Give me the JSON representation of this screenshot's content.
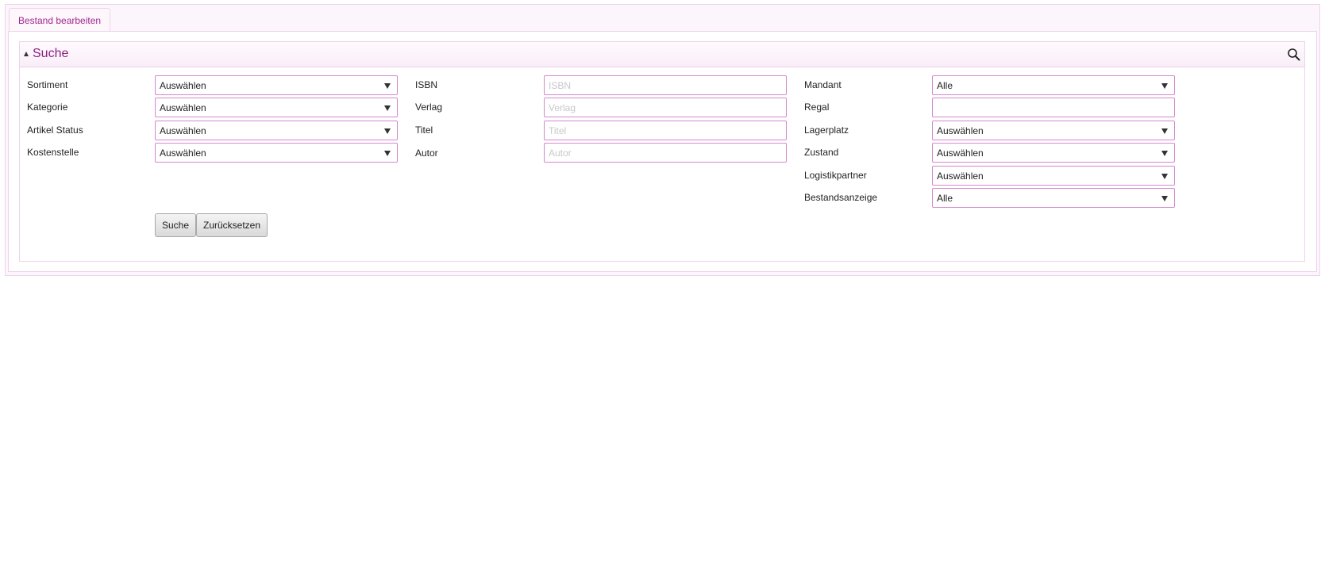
{
  "tabs": [
    {
      "label": "Bestand bearbeiten"
    }
  ],
  "search_panel": {
    "title": "Suche",
    "search_icon": "search-icon",
    "collapse_icon": "triangle-up-icon"
  },
  "columns": {
    "left": [
      {
        "label": "Sortiment",
        "value": "Auswählen"
      },
      {
        "label": "Kategorie",
        "value": "Auswählen"
      },
      {
        "label": "Artikel Status",
        "value": "Auswählen"
      },
      {
        "label": "Kostenstelle",
        "value": "Auswählen"
      }
    ],
    "middle": [
      {
        "label": "ISBN",
        "placeholder": "ISBN"
      },
      {
        "label": "Verlag",
        "placeholder": "Verlag"
      },
      {
        "label": "Titel",
        "placeholder": "Titel"
      },
      {
        "label": "Autor",
        "placeholder": "Autor"
      }
    ],
    "right": [
      {
        "label": "Mandant",
        "value": "Alle"
      },
      {
        "label": "Regal",
        "value": ""
      },
      {
        "label": "Lagerplatz",
        "value": "Auswählen"
      },
      {
        "label": "Zustand",
        "value": "Auswählen"
      },
      {
        "label": "Logistikpartner",
        "value": "Auswählen"
      },
      {
        "label": "Bestandsanzeige",
        "value": "Alle"
      }
    ]
  },
  "buttons": {
    "search": "Suche",
    "reset": "Zurücksetzen"
  },
  "colors": {
    "accent": "#8b1f7f",
    "border": "#d488cb",
    "panel_border": "#ecd3ea"
  }
}
